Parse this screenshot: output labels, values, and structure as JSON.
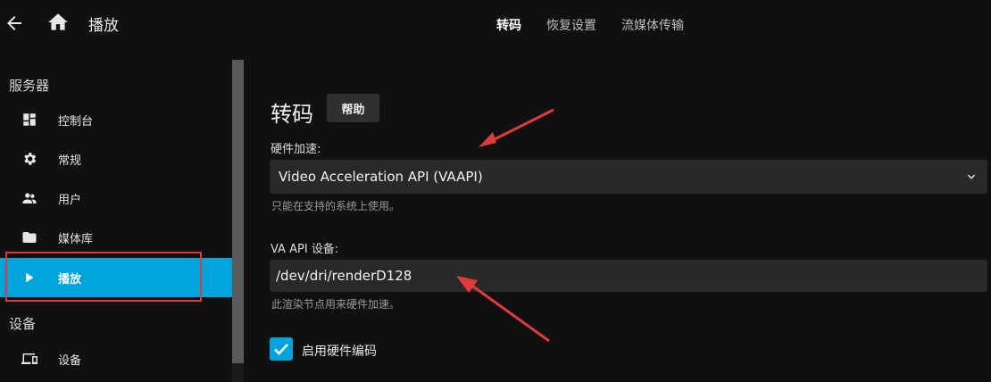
{
  "header": {
    "title": "播放",
    "back_icon": "arrow-left-icon",
    "home_icon": "home-icon",
    "tabs": [
      {
        "label": "转码",
        "active": true
      },
      {
        "label": "恢复设置",
        "active": false
      },
      {
        "label": "流媒体传输",
        "active": false
      }
    ]
  },
  "sidebar": {
    "sections": [
      {
        "title": "服务器"
      },
      {
        "title": "设备"
      }
    ],
    "items": [
      {
        "label": "控制台",
        "icon": "dashboard-icon"
      },
      {
        "label": "常规",
        "icon": "gear-icon"
      },
      {
        "label": "用户",
        "icon": "users-icon"
      },
      {
        "label": "媒体库",
        "icon": "folder-icon"
      },
      {
        "label": "播放",
        "icon": "play-icon",
        "active": true
      },
      {
        "label": "设备",
        "icon": "devices-icon"
      }
    ]
  },
  "main": {
    "heading": "转码",
    "help_label": "帮助",
    "hw_accel_label": "硬件加速:",
    "hw_accel_value": "Video Acceleration API (VAAPI)",
    "hw_accel_hint": "只能在支持的系统上使用。",
    "vaapi_device_label": "VA API 设备:",
    "vaapi_device_value": "/dev/dri/renderD128",
    "vaapi_device_hint": "此渲染节点用来硬件加速。",
    "enable_hw_encoding_label": "启用硬件编码",
    "enable_hw_encoding_checked": true
  },
  "colors": {
    "accent": "#00a4dc",
    "annotation": "#e03a3a",
    "background": "#101010",
    "field": "#292929"
  }
}
